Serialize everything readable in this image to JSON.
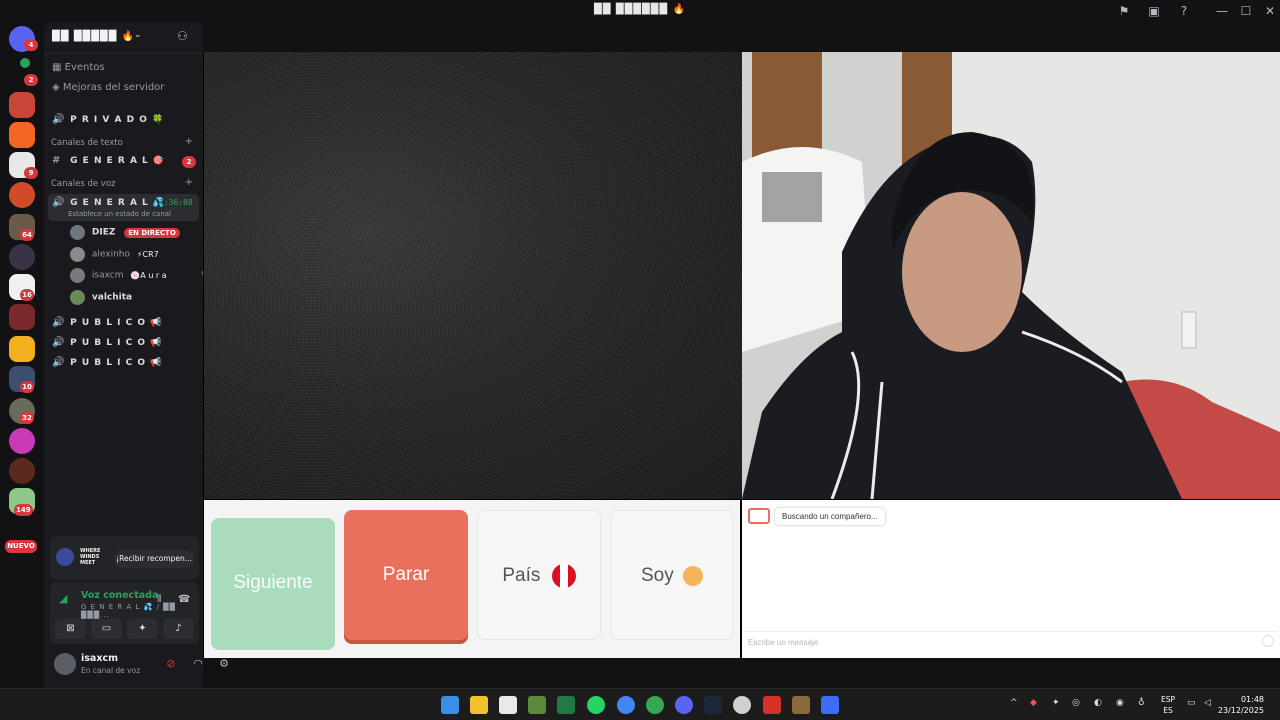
{
  "window": {
    "title": "██ ██████ 🔥"
  },
  "server": {
    "name": "██ █████ 🔥"
  },
  "sidebar": {
    "events": "Eventos",
    "boosts": "Mejoras del servidor",
    "private_channel": "P R I V A D O 🍀",
    "text_category": "Canales de texto",
    "general_text": "G E N E R A L 🎯",
    "general_text_badge": "2",
    "voice_category": "Canales de voz",
    "general_voice": "G E N E R A L 💦",
    "general_voice_time": "1:36:08",
    "channel_status": "Establece un estado de canal",
    "voice_users": [
      {
        "name": "DIEZ",
        "tag": "EN DIRECTO"
      },
      {
        "name": "alexinho",
        "tag": "⚡CR7"
      },
      {
        "name": "isaxcm",
        "tag": "🍥A u r a"
      },
      {
        "name": "valchita",
        "tag": ""
      }
    ],
    "public_channels": [
      "P U B L I C O 📢",
      "P U B L I C O 📢",
      "P U B L I C O 📢"
    ]
  },
  "rail": {
    "badges": [
      "4",
      "2",
      "9",
      "64",
      "16",
      "10",
      "32",
      "149"
    ],
    "nuevo": "NUEVO"
  },
  "promo": {
    "game": "WHERE WINDS MEET",
    "button": "¡Recibir recompen..."
  },
  "voice_panel": {
    "status": "Voz conectada",
    "channel": "G E N E R A L 💦 / ██ ███..."
  },
  "user_panel": {
    "username": "isaxcm",
    "status": "En canal de voz"
  },
  "controls": {
    "next": "Siguiente",
    "stop": "Parar",
    "country": "País",
    "gender": "Soy"
  },
  "chat": {
    "status_message": "Buscando un compañero...",
    "input_placeholder": "Escribe un mensaje"
  },
  "taskbar": {
    "lang_top": "ESP",
    "lang_bottom": "ES",
    "time": "01:48",
    "date": "23/12/2025"
  }
}
